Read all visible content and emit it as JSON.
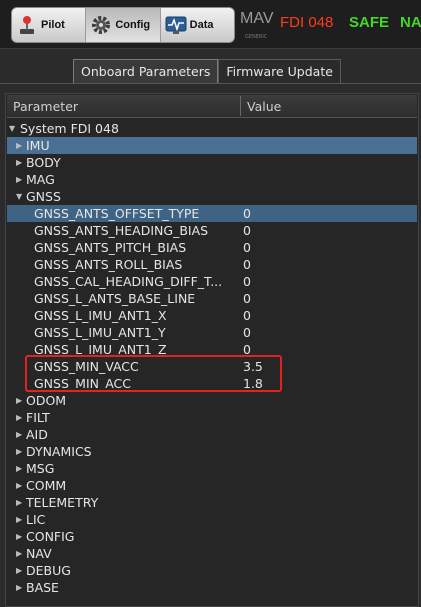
{
  "toolbar": {
    "tabs": [
      {
        "label": "Pilot",
        "icon": "joystick-icon"
      },
      {
        "label": "Config",
        "icon": "gear-icon"
      },
      {
        "label": "Data",
        "icon": "monitor-graph-icon"
      }
    ],
    "brand": "MAV",
    "brand_sub": "GENERIC",
    "device": "FDI 048",
    "safe": "SAFE",
    "nav": "NA",
    "colors": {
      "device": "#ff3b1f",
      "safe": "#44d629"
    }
  },
  "subtabs": [
    "Onboard Parameters",
    "Firmware Update"
  ],
  "tree": {
    "headers": {
      "parameter": "Parameter",
      "value": "Value"
    },
    "root": "System FDI 048",
    "groups_before": [
      "IMU",
      "BODY",
      "MAG"
    ],
    "expanded_group": "GNSS",
    "params": [
      {
        "name": "GNSS_ANTS_OFFSET_TYPE",
        "value": "0"
      },
      {
        "name": "GNSS_ANTS_HEADING_BIAS",
        "value": "0"
      },
      {
        "name": "GNSS_ANTS_PITCH_BIAS",
        "value": "0"
      },
      {
        "name": "GNSS_ANTS_ROLL_BIAS",
        "value": "0"
      },
      {
        "name": "GNSS_CAL_HEADING_DIFF_T...",
        "value": "0"
      },
      {
        "name": "GNSS_L_ANTS_BASE_LINE",
        "value": "0"
      },
      {
        "name": "GNSS_L_IMU_ANT1_X",
        "value": "0"
      },
      {
        "name": "GNSS_L_IMU_ANT1_Y",
        "value": "0"
      },
      {
        "name": "GNSS_L_IMU_ANT1_Z",
        "value": "0"
      },
      {
        "name": "GNSS_MIN_VACC",
        "value": "3.5"
      },
      {
        "name": "GNSS_MIN_ACC",
        "value": "1.8"
      }
    ],
    "groups_after": [
      "ODOM",
      "FILT",
      "AID",
      "DYNAMICS",
      "MSG",
      "COMM",
      "TELEMETRY",
      "LIC",
      "CONFIG",
      "NAV",
      "DEBUG",
      "BASE"
    ]
  }
}
